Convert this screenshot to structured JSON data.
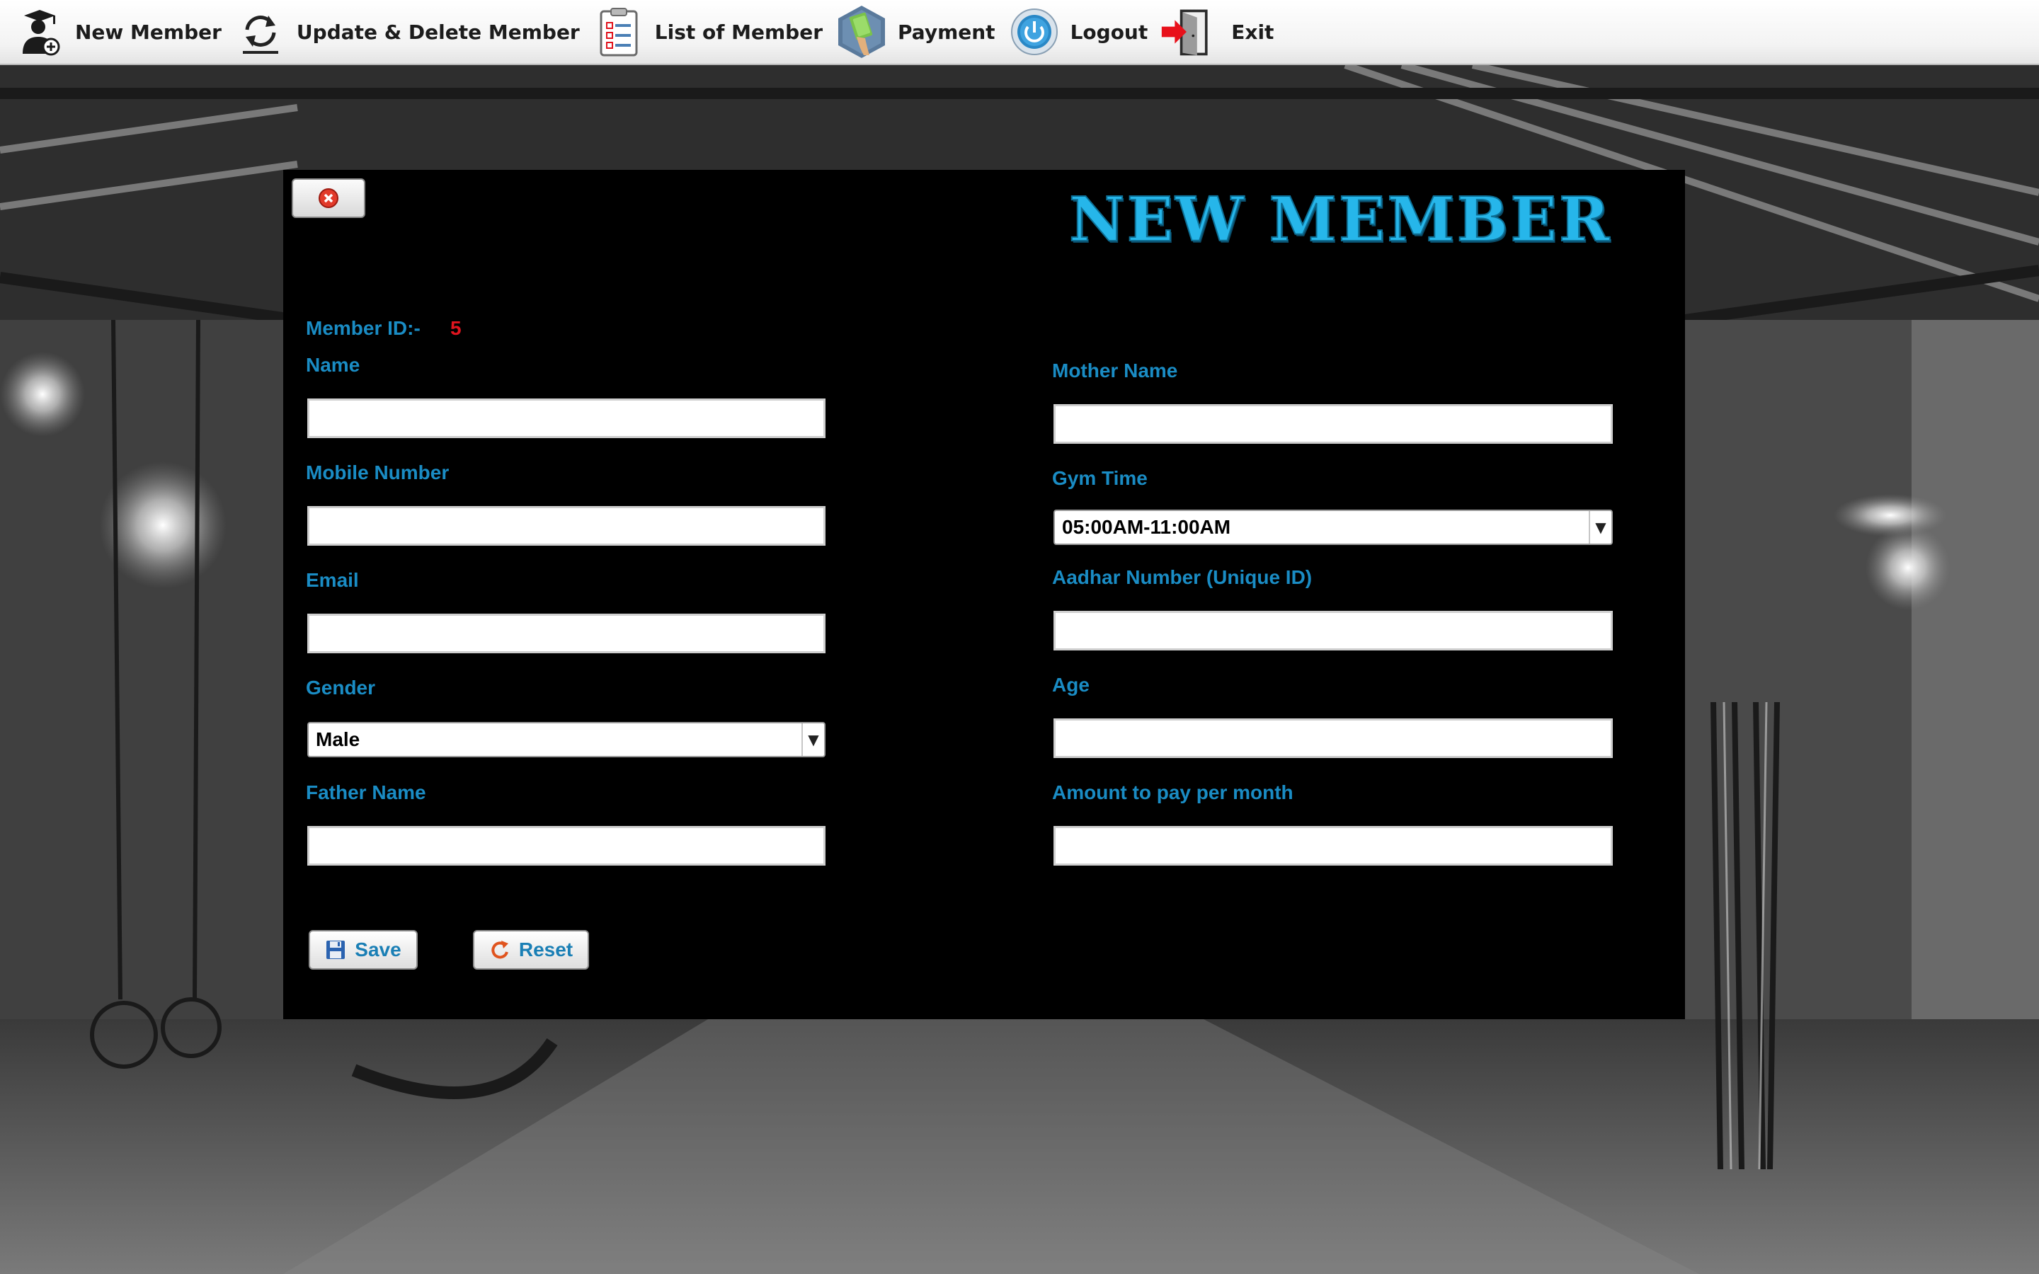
{
  "toolbar": {
    "items": [
      {
        "label": "New Member",
        "icon": "add-user-icon"
      },
      {
        "label": "Update & Delete Member",
        "icon": "refresh-icon"
      },
      {
        "label": "List of Member",
        "icon": "checklist-icon"
      },
      {
        "label": "Payment",
        "icon": "payment-icon"
      },
      {
        "label": "Logout",
        "icon": "power-icon"
      },
      {
        "label": "Exit",
        "icon": "exit-door-icon"
      }
    ]
  },
  "form": {
    "title": "NEW MEMBER",
    "member_id_label": "Member ID:-",
    "member_id_value": "5",
    "fields": {
      "name": {
        "label": "Name",
        "value": ""
      },
      "mobile": {
        "label": "Mobile Number",
        "value": ""
      },
      "email": {
        "label": "Email",
        "value": ""
      },
      "gender": {
        "label": "Gender",
        "value": "Male"
      },
      "father_name": {
        "label": "Father Name",
        "value": ""
      },
      "mother_name": {
        "label": "Mother Name",
        "value": ""
      },
      "gym_time": {
        "label": "Gym Time",
        "value": "05:00AM-11:00AM"
      },
      "aadhar": {
        "label": "Aadhar Number (Unique ID)",
        "value": ""
      },
      "age": {
        "label": "Age",
        "value": ""
      },
      "amount": {
        "label": "Amount to pay per month",
        "value": ""
      }
    },
    "save_label": "Save",
    "reset_label": "Reset"
  },
  "colors": {
    "accent": "#1a8cc4",
    "title": "#26b6ea",
    "member_id": "#e0141e",
    "panel_bg": "#000000"
  }
}
